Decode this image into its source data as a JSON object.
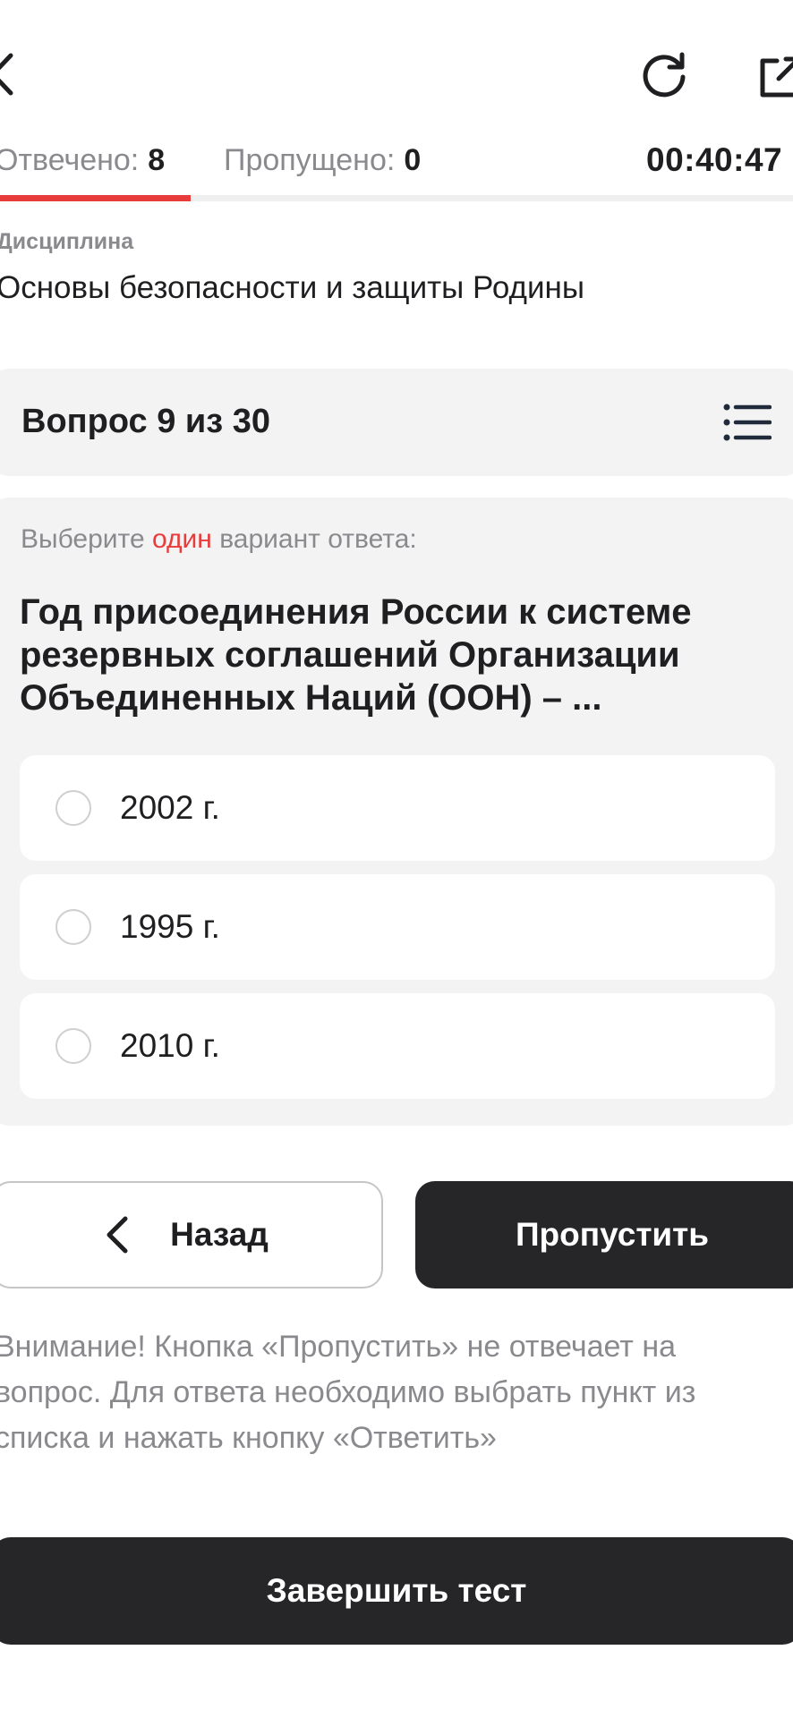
{
  "status": {
    "answered_label": "Отвечено:",
    "answered_value": "8",
    "skipped_label": "Пропущено:",
    "skipped_value": "0",
    "timer": "00:40:47",
    "progress_fraction": 0.24
  },
  "discipline": {
    "label": "Дисциплина",
    "title": "Основы безопасности и защиты Родины"
  },
  "question": {
    "counter": "Вопрос 9 из 30",
    "instruction_prefix": "Выберите",
    "instruction_accent": "один",
    "instruction_suffix": "вариант ответа:",
    "text": "Год присоединения России к системе резервных соглашений Организации Объединенных Наций (ООН) – ...",
    "options": [
      "2002 г.",
      "1995 г.",
      "2010 г."
    ]
  },
  "buttons": {
    "back": "Назад",
    "skip": "Пропустить",
    "finish": "Завершить тест"
  },
  "warning": "Внимание! Кнопка «Пропустить» не отвечает на вопрос. Для ответа необходимо выбрать пункт из списка и нажать кнопку «Ответить»",
  "colors": {
    "accent": "#e83b3b",
    "dark_button": "#262628",
    "panel": "#f3f3f3"
  },
  "icons": {
    "back": "chevron-left-icon",
    "refresh": "refresh-icon",
    "share": "external-link-icon",
    "list": "list-icon"
  }
}
